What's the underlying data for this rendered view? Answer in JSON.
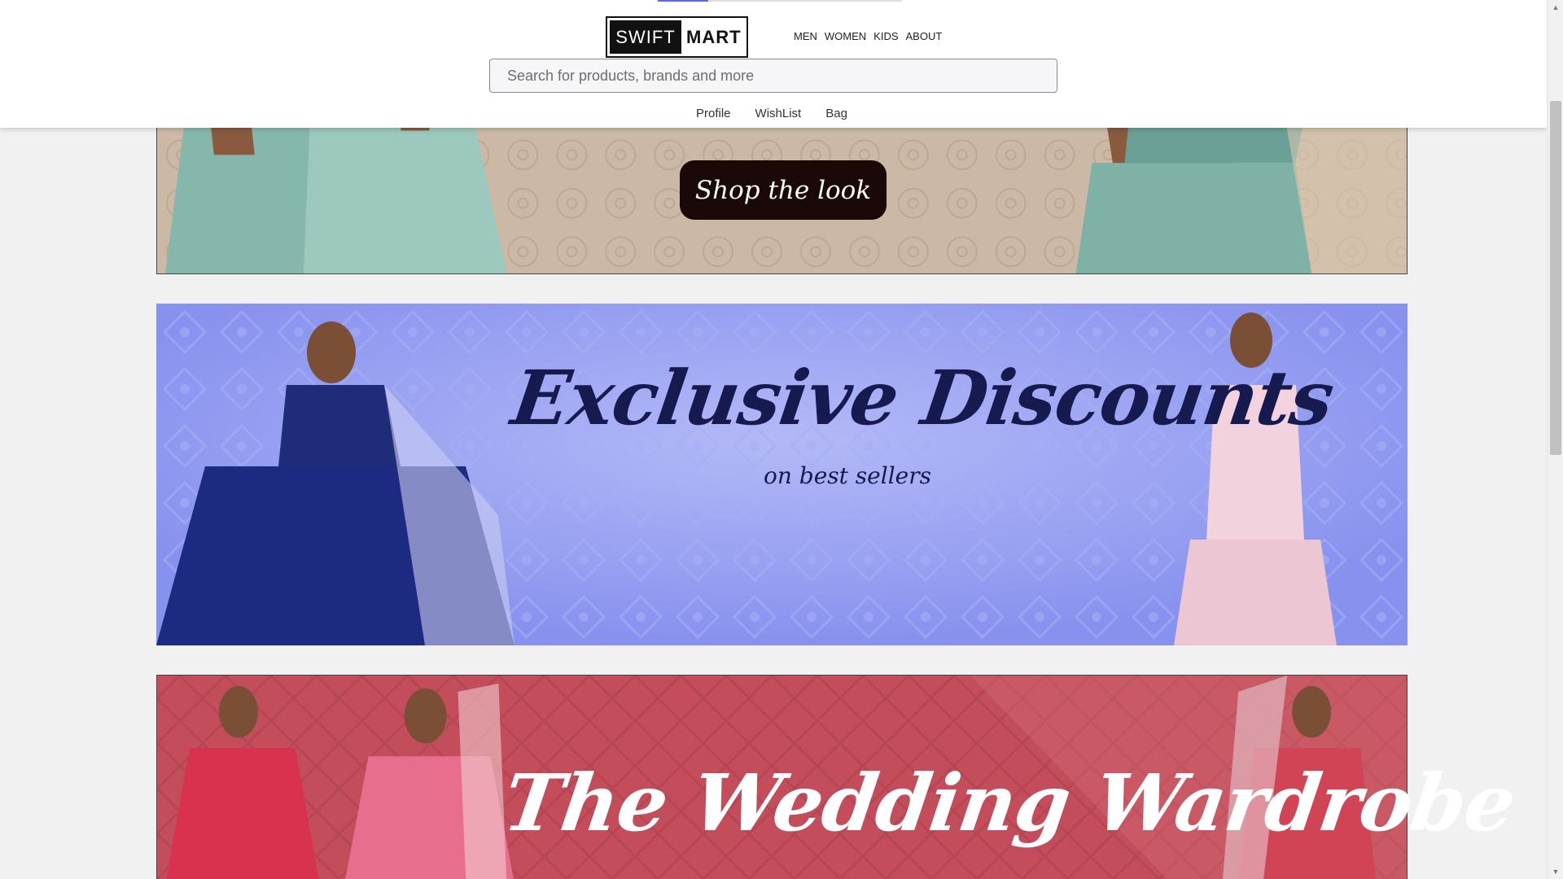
{
  "header": {
    "logo": {
      "part1": "SWIFT",
      "part2": "MART"
    },
    "nav": [
      "MEN",
      "WOMEN",
      "KIDS",
      "ABOUT"
    ],
    "search": {
      "placeholder": "Search for products, brands and more",
      "value": ""
    },
    "sub_nav": [
      "Profile",
      "WishList",
      "Bag"
    ]
  },
  "banners": {
    "look": {
      "button_label": "Shop the look"
    },
    "discounts": {
      "headline": "Exclusive Discounts",
      "subheadline": "on best sellers"
    },
    "wedding": {
      "headline": "The Wedding Wardrobe"
    }
  },
  "colors": {
    "header_bg": "#ffffff",
    "page_bg": "#f1f1f1",
    "banner_look_bg": "#c9b7a3",
    "banner_discount_bg": "#8e9af0",
    "banner_wedding_bg": "#c24c5a",
    "accent": "#5b6bd6"
  },
  "icons": {
    "scroll_up": "chevron-up-icon",
    "scroll_down": "chevron-down-icon"
  }
}
